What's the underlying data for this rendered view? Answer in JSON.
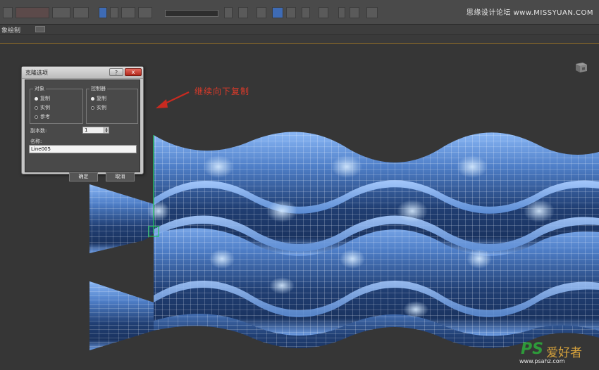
{
  "watermark_top": "思缘设计论坛 www.MISSYUAN.COM",
  "ribbon": {
    "label": "象绘制"
  },
  "dialog": {
    "title": "克隆选项",
    "help": "?",
    "close": "x",
    "object_group": {
      "legend": "对象",
      "options": [
        {
          "label": "复制",
          "selected": true
        },
        {
          "label": "实例",
          "selected": false
        },
        {
          "label": "参考",
          "selected": false
        }
      ]
    },
    "controller_group": {
      "legend": "控制器",
      "options": [
        {
          "label": "复制",
          "selected": true
        },
        {
          "label": "实例",
          "selected": false
        }
      ]
    },
    "copies_label": "副本数:",
    "copies_value": "1",
    "name_label": "名称:",
    "name_value": "Line005",
    "ok_label": "确定",
    "cancel_label": "取消"
  },
  "annotation": "继续向下复制",
  "watermark_bottom": {
    "logo": "PS",
    "brand": "爱好者",
    "url": "www.psahz.com"
  },
  "colors": {
    "mesh_light": "#7aaaf0",
    "mesh_dark": "#142748",
    "wire": "#ffffff",
    "arrow": "#c82a20",
    "selection": "#22c55e"
  }
}
